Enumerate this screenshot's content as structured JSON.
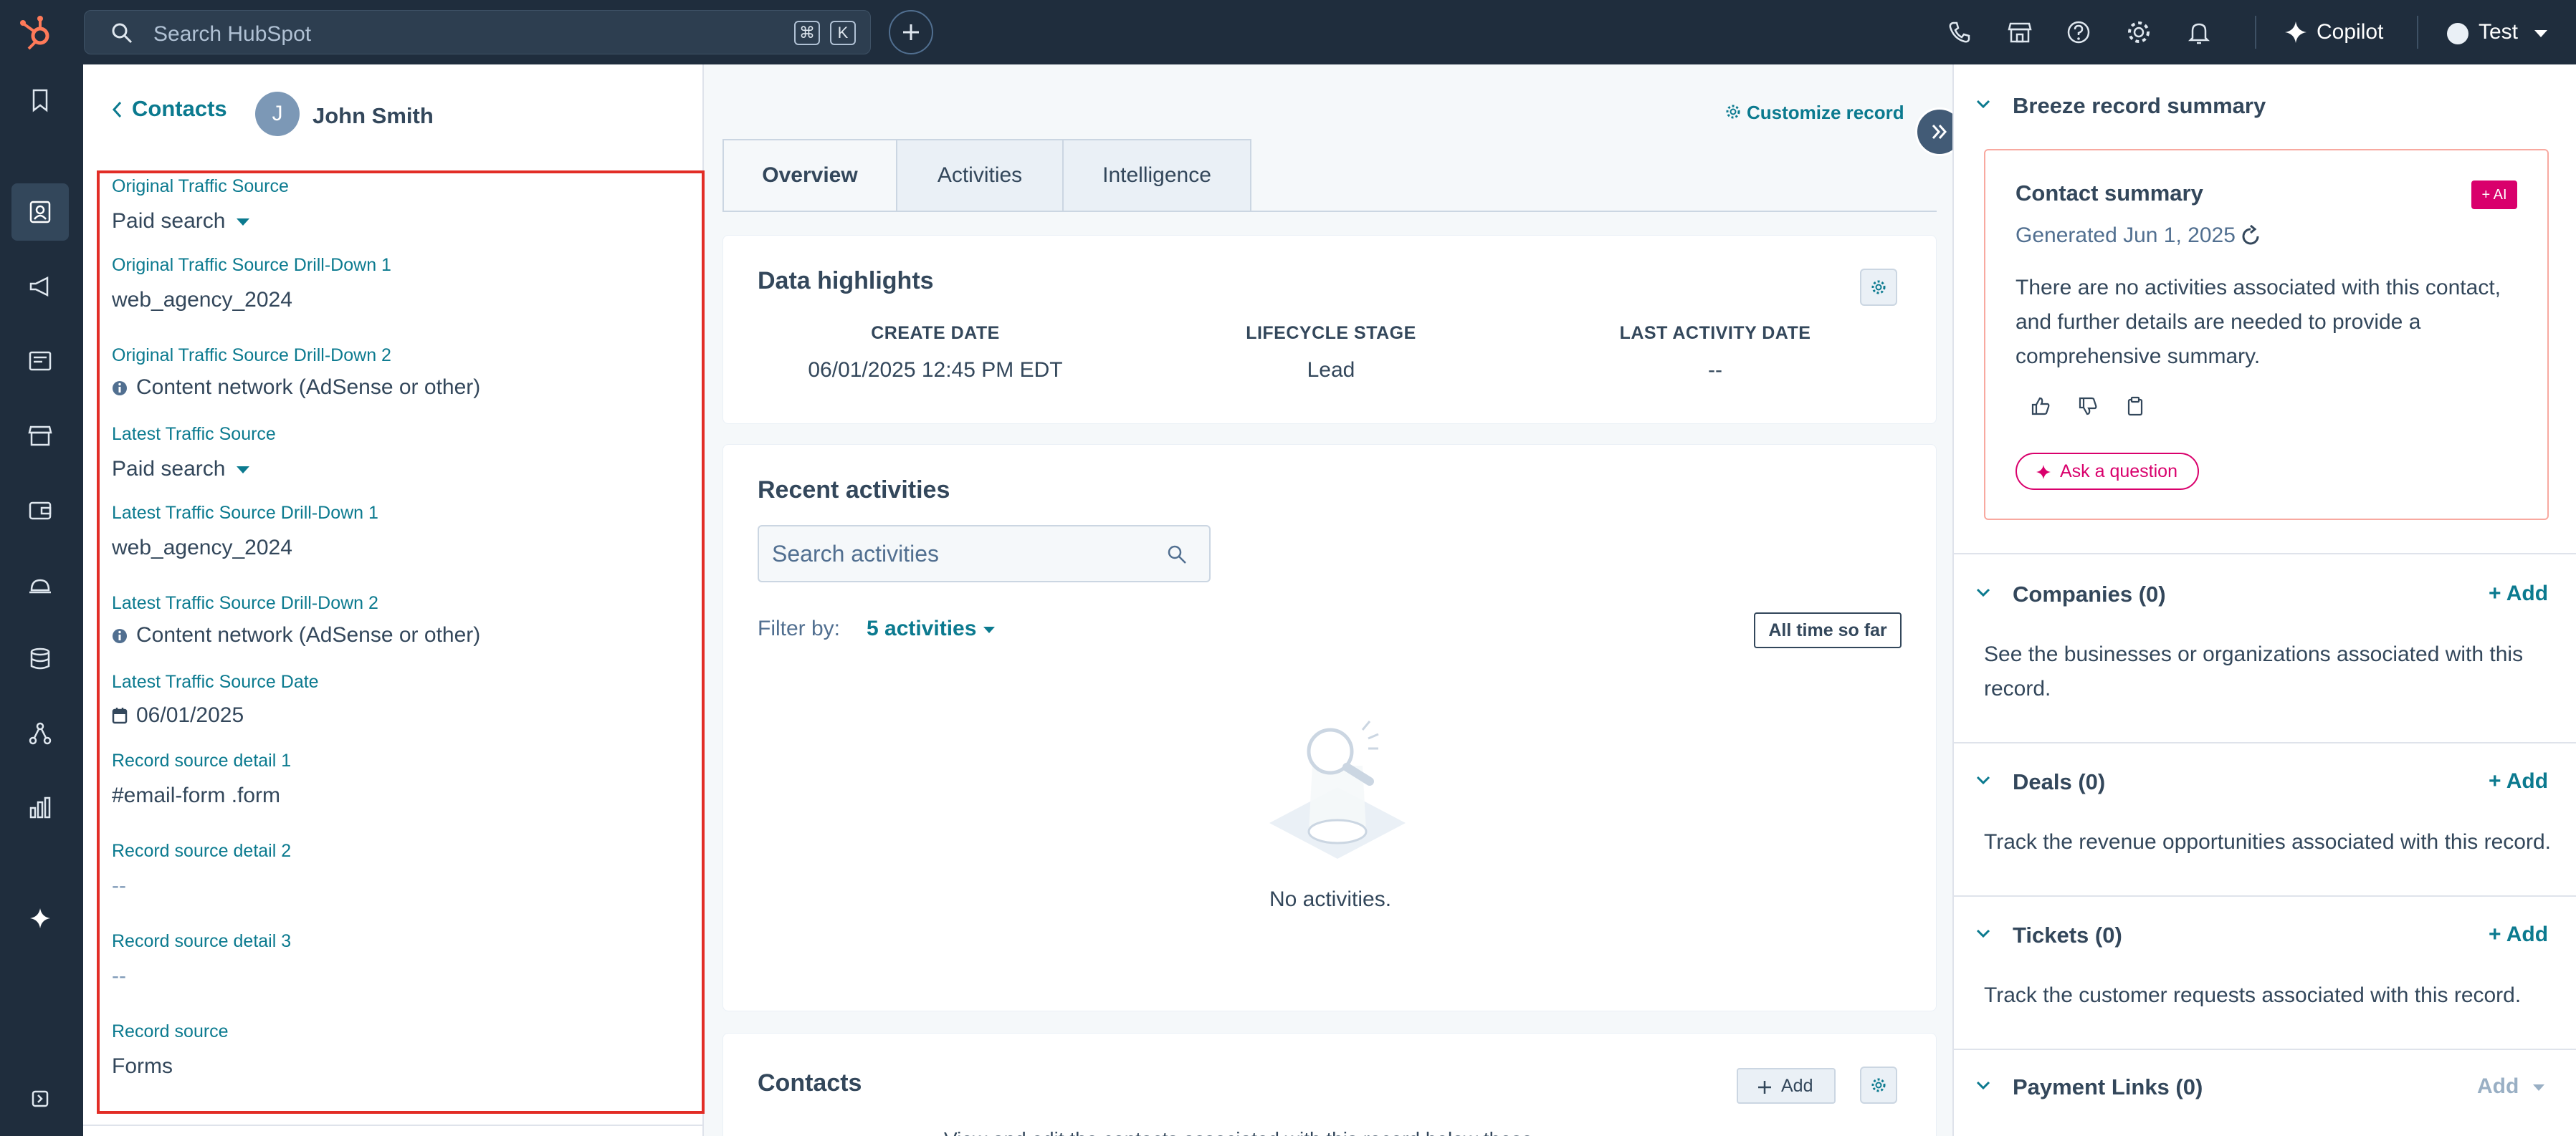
{
  "topbar": {
    "search_placeholder": "Search HubSpot",
    "shortcut_key1": "⌘",
    "shortcut_key2": "K",
    "copilot_label": "Copilot",
    "account_name": "Test"
  },
  "contact": {
    "back_label": "Contacts",
    "avatar_initial": "J",
    "name": "John Smith"
  },
  "properties": [
    {
      "label": "Original Traffic Source",
      "value": "Paid search"
    },
    {
      "label": "Original Traffic Source Drill-Down 1",
      "value": "web_agency_2024"
    },
    {
      "label": "Original Traffic Source Drill-Down 2",
      "value": "Content network (AdSense or other)"
    },
    {
      "label": "Latest Traffic Source",
      "value": "Paid search"
    },
    {
      "label": "Latest Traffic Source Drill-Down 1",
      "value": "web_agency_2024"
    },
    {
      "label": "Latest Traffic Source Drill-Down 2",
      "value": "Content network (AdSense or other)"
    },
    {
      "label": "Latest Traffic Source Date",
      "value": "06/01/2025"
    },
    {
      "label": "Record source detail 1",
      "value": "#email-form .form"
    },
    {
      "label": "Record source detail 2",
      "value": "--"
    },
    {
      "label": "Record source detail 3",
      "value": "--"
    },
    {
      "label": "Record source",
      "value": "Forms"
    }
  ],
  "main": {
    "customize_label": "Customize record",
    "tabs": [
      {
        "label": "Overview"
      },
      {
        "label": "Activities"
      },
      {
        "label": "Intelligence"
      }
    ],
    "highlights": {
      "title": "Data highlights",
      "columns": [
        {
          "header": "CREATE DATE",
          "value": "06/01/2025 12:45 PM EDT"
        },
        {
          "header": "LIFECYCLE STAGE",
          "value": "Lead"
        },
        {
          "header": "LAST ACTIVITY DATE",
          "value": "--"
        }
      ]
    },
    "recent": {
      "title": "Recent activities",
      "search_placeholder": "Search activities",
      "filter_label": "Filter by:",
      "filter_value": "5 activities",
      "time_range": "All time so far",
      "empty_text": "No activities."
    },
    "contacts_card": {
      "title": "Contacts",
      "add_label": "Add",
      "cutoff_text": "View and edit the contacts associated with this record below these"
    }
  },
  "right": {
    "breeze_title": "Breeze record summary",
    "summary": {
      "title": "Contact summary",
      "ai_badge": "+ AI",
      "generated": "Generated Jun 1, 2025",
      "body": "There are no activities associated with this contact, and further details are needed to provide a comprehensive summary.",
      "ask_label": "Ask a question"
    },
    "sections": [
      {
        "title": "Companies (0)",
        "add": "+ Add",
        "desc": "See the businesses or organizations associated with this record."
      },
      {
        "title": "Deals (0)",
        "add": "+ Add",
        "desc": "Track the revenue opportunities associated with this record."
      },
      {
        "title": "Tickets (0)",
        "add": "+ Add",
        "desc": "Track the customer requests associated with this record."
      },
      {
        "title": "Payment Links (0)",
        "add": "Add",
        "desc": ""
      }
    ]
  },
  "colors": {
    "topbar_bg": "#1f2d3d",
    "accent_teal": "#0b7a8f",
    "ai_pink": "#d9006c",
    "highlight_red": "#e22d26"
  }
}
